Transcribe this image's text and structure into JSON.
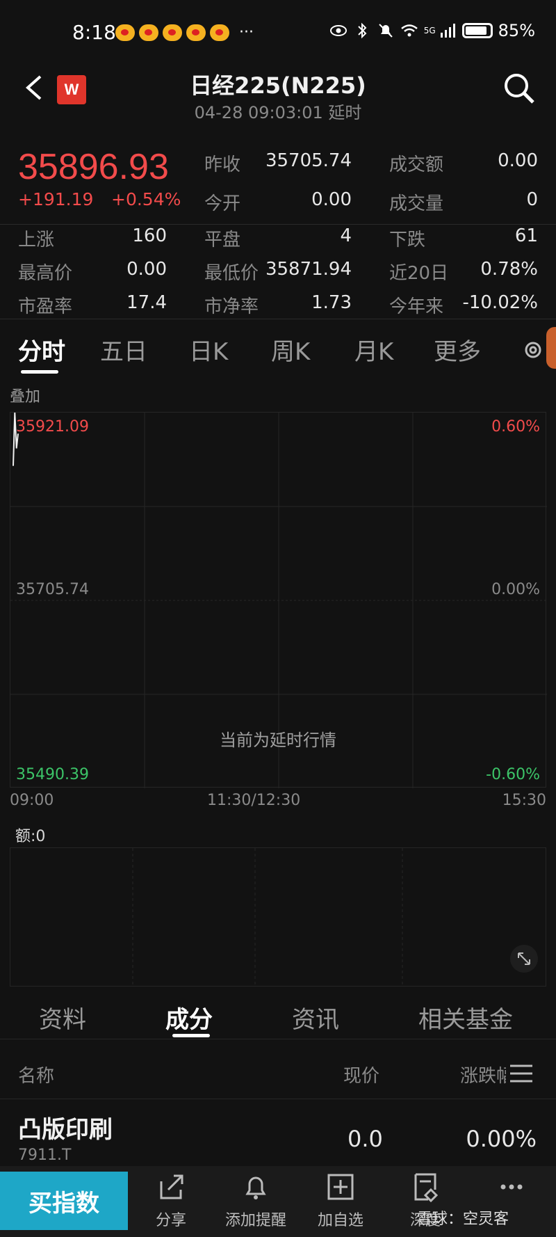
{
  "status_bar": {
    "time": "8:18",
    "more": "···",
    "network": "5G",
    "battery": "85%"
  },
  "header": {
    "title": "日经225(N225)",
    "subtitle": "04-28 09:03:01 延时",
    "logo_text": "W"
  },
  "quote": {
    "price": "35896.93",
    "change": "+191.19",
    "change_pct": "+0.54%",
    "accent_color": "#f24b4b",
    "stats": [
      {
        "label": "昨收",
        "value": "35705.74"
      },
      {
        "label": "成交额",
        "value": "0.00"
      },
      {
        "label": "今开",
        "value": "0.00"
      },
      {
        "label": "成交量",
        "value": "0"
      },
      {
        "label": "上涨",
        "value": "160"
      },
      {
        "label": "平盘",
        "value": "4"
      },
      {
        "label": "下跌",
        "value": "61"
      },
      {
        "label": "最高价",
        "value": "0.00"
      },
      {
        "label": "最低价",
        "value": "35871.94"
      },
      {
        "label": "近20日",
        "value": "0.78%"
      },
      {
        "label": "市盈率",
        "value": "17.4"
      },
      {
        "label": "市净率",
        "value": "1.73"
      },
      {
        "label": "今年来",
        "value": "-10.02%"
      }
    ]
  },
  "chart_tabs": [
    "分时",
    "五日",
    "日K",
    "周K",
    "月K",
    "更多"
  ],
  "overlay_label": "叠加",
  "chart_data": {
    "type": "line",
    "y_left_labels": [
      "35921.09",
      "35705.74",
      "35490.39"
    ],
    "y_right_labels": [
      "0.60%",
      "0.00%",
      "-0.60%"
    ],
    "x_labels": [
      "09:00",
      "11:30/12:30",
      "15:30"
    ],
    "ylim": [
      35490.39,
      35921.09
    ],
    "reference": 35705.74,
    "series": [
      {
        "x": [
          "09:00",
          "09:01",
          "09:02",
          "09:03"
        ],
        "values": [
          35860,
          35921.09,
          35880,
          35896.93
        ]
      }
    ]
  },
  "delay_note": "当前为延时行情",
  "volume_label": "额:0",
  "info_tabs": [
    "资料",
    "成分",
    "资讯",
    "相关基金"
  ],
  "table": {
    "headers": {
      "name": "名称",
      "price": "现价",
      "change": "涨跌幅"
    },
    "rows": [
      {
        "name": "凸版印刷",
        "code": "7911.T",
        "price": "0.0",
        "change": "0.00%"
      }
    ]
  },
  "bottom_bar": {
    "buy_label": "买指数",
    "items": [
      "分享",
      "添加提醒",
      "加自选",
      "深度"
    ],
    "watermark": "雪球：空灵客"
  }
}
